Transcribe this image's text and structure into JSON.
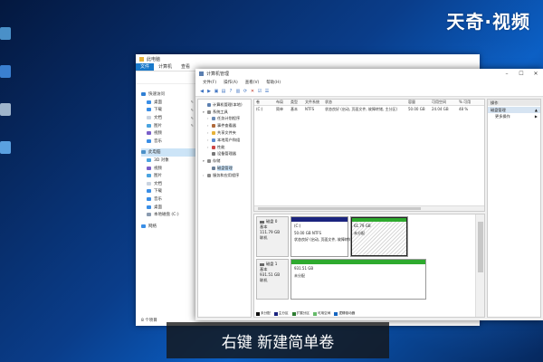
{
  "watermark": "天奇·视频",
  "caption": "右键 新建简单卷",
  "colors": {
    "explorer_file_tab": "#1979ca",
    "volume_primary_bar": "#1a237e",
    "volume_unallocated_bar": "#2eaa2e",
    "caption_bg": "#141414"
  },
  "explorer": {
    "title": "此电脑",
    "ribbon_tabs": [
      "文件",
      "计算机",
      "查看"
    ],
    "nav": [
      {
        "label": "快速访问",
        "icon": "star-icon",
        "color": "#2f7fd4",
        "pin": false,
        "indent": false
      },
      {
        "label": "桌面",
        "icon": "desktop-icon",
        "color": "#3a8ee6",
        "pin": true,
        "indent": true
      },
      {
        "label": "下载",
        "icon": "download-icon",
        "color": "#3a8ee6",
        "pin": true,
        "indent": true
      },
      {
        "label": "文档",
        "icon": "document-icon",
        "color": "#c9d3e0",
        "pin": true,
        "indent": true
      },
      {
        "label": "图片",
        "icon": "picture-icon",
        "color": "#4aa3df",
        "pin": true,
        "indent": true
      },
      {
        "label": "视频",
        "icon": "video-icon",
        "color": "#7a5fc9",
        "pin": false,
        "indent": true
      },
      {
        "label": "音乐",
        "icon": "music-icon",
        "color": "#3a8ee6",
        "pin": false,
        "indent": true
      },
      {
        "gap": true
      },
      {
        "label": "此电脑",
        "icon": "computer-icon",
        "color": "#4a90c8",
        "pin": false,
        "indent": false,
        "sel": true
      },
      {
        "label": "3D 对象",
        "icon": "cube-icon",
        "color": "#4aa3df",
        "pin": false,
        "indent": true
      },
      {
        "label": "视频",
        "icon": "video-icon",
        "color": "#7a5fc9",
        "pin": false,
        "indent": true
      },
      {
        "label": "图片",
        "icon": "picture-icon",
        "color": "#4aa3df",
        "pin": false,
        "indent": true
      },
      {
        "label": "文档",
        "icon": "document-icon",
        "color": "#c9d3e0",
        "pin": false,
        "indent": true
      },
      {
        "label": "下载",
        "icon": "download-icon",
        "color": "#3a8ee6",
        "pin": false,
        "indent": true
      },
      {
        "label": "音乐",
        "icon": "music-icon",
        "color": "#3a8ee6",
        "pin": false,
        "indent": true
      },
      {
        "label": "桌面",
        "icon": "desktop-icon",
        "color": "#3a8ee6",
        "pin": false,
        "indent": true
      },
      {
        "label": "本地磁盘 (C:)",
        "icon": "drive-icon",
        "color": "#8a9bb0",
        "pin": false,
        "indent": true
      },
      {
        "gap": true
      },
      {
        "label": "网络",
        "icon": "network-icon",
        "color": "#3a8ee6",
        "pin": false,
        "indent": false
      }
    ],
    "status": "8 个项目"
  },
  "cm": {
    "title": "计算机管理",
    "menu": [
      "文件(F)",
      "操作(A)",
      "查看(V)",
      "帮助(H)"
    ],
    "tree": [
      {
        "label": "计算机管理(本地)",
        "level": 0,
        "toggle": "",
        "icon": "computer-manage-icon",
        "color": "#5b7fb0"
      },
      {
        "label": "系统工具",
        "level": 0,
        "toggle": "▾",
        "icon": "tools-icon",
        "color": "#8a8a8a"
      },
      {
        "label": "任务计划程序",
        "level": 1,
        "toggle": "›",
        "icon": "clock-icon",
        "color": "#6a8ab5"
      },
      {
        "label": "事件查看器",
        "level": 1,
        "toggle": "›",
        "icon": "event-viewer-icon",
        "color": "#b06a3a"
      },
      {
        "label": "共享文件夹",
        "level": 1,
        "toggle": "›",
        "icon": "shared-folder-icon",
        "color": "#e6b23a"
      },
      {
        "label": "本地用户和组",
        "level": 1,
        "toggle": "›",
        "icon": "users-icon",
        "color": "#5a8ad0"
      },
      {
        "label": "性能",
        "level": 1,
        "toggle": "›",
        "icon": "performance-icon",
        "color": "#c44"
      },
      {
        "label": "设备管理器",
        "level": 1,
        "toggle": "",
        "icon": "device-manager-icon",
        "color": "#777"
      },
      {
        "label": "存储",
        "level": 0,
        "toggle": "▾",
        "icon": "storage-icon",
        "color": "#8a8a8a"
      },
      {
        "label": "磁盘管理",
        "level": 1,
        "toggle": "",
        "icon": "disk-manage-icon",
        "color": "#6a7f99",
        "sel": true
      },
      {
        "label": "服务和应用程序",
        "level": 0,
        "toggle": "›",
        "icon": "services-icon",
        "color": "#8a8a8a"
      }
    ],
    "volume_table": {
      "headers": [
        "卷",
        "布局",
        "类型",
        "文件系统",
        "状态",
        "容量",
        "可用空间",
        "% 可用"
      ],
      "rows": [
        [
          "(C:)",
          "简单",
          "基本",
          "NTFS",
          "状态良好 (启动, 页面文件, 故障转储, 主分区)",
          "50.00 GB",
          "24.04 GB",
          "48 %"
        ]
      ]
    },
    "disks": [
      {
        "name": "磁盘 0",
        "type": "基本",
        "size": "111.79 GB",
        "status": "联机",
        "partitions": [
          {
            "label": "(C:)",
            "size_fs": "50.00 GB NTFS",
            "status": "状态良好 (启动, 页面文件, 故障转储, 主分区)",
            "bar_color": "#1a237e",
            "hatch": false
          },
          {
            "label": "",
            "size_fs": "61.79 GB",
            "status": "未分配",
            "bar_color": "#2eaa2e",
            "hatch": true
          }
        ]
      },
      {
        "name": "磁盘 1",
        "type": "基本",
        "size": "931.51 GB",
        "status": "联机",
        "partitions": [
          {
            "label": "",
            "size_fs": "931.51 GB",
            "status": "未分配",
            "bar_color": "#2eaa2e",
            "hatch": false
          }
        ]
      }
    ],
    "legend": [
      {
        "label": "未分配",
        "color": "#111111"
      },
      {
        "label": "主分区",
        "color": "#1a237e"
      },
      {
        "label": "扩展分区",
        "color": "#2e7d32"
      },
      {
        "label": "可用空间",
        "color": "#66bb6a"
      },
      {
        "label": "逻辑驱动器",
        "color": "#1565c0"
      }
    ],
    "actions": {
      "header": "操作",
      "sub": "磁盘管理",
      "item": "更多操作"
    }
  }
}
